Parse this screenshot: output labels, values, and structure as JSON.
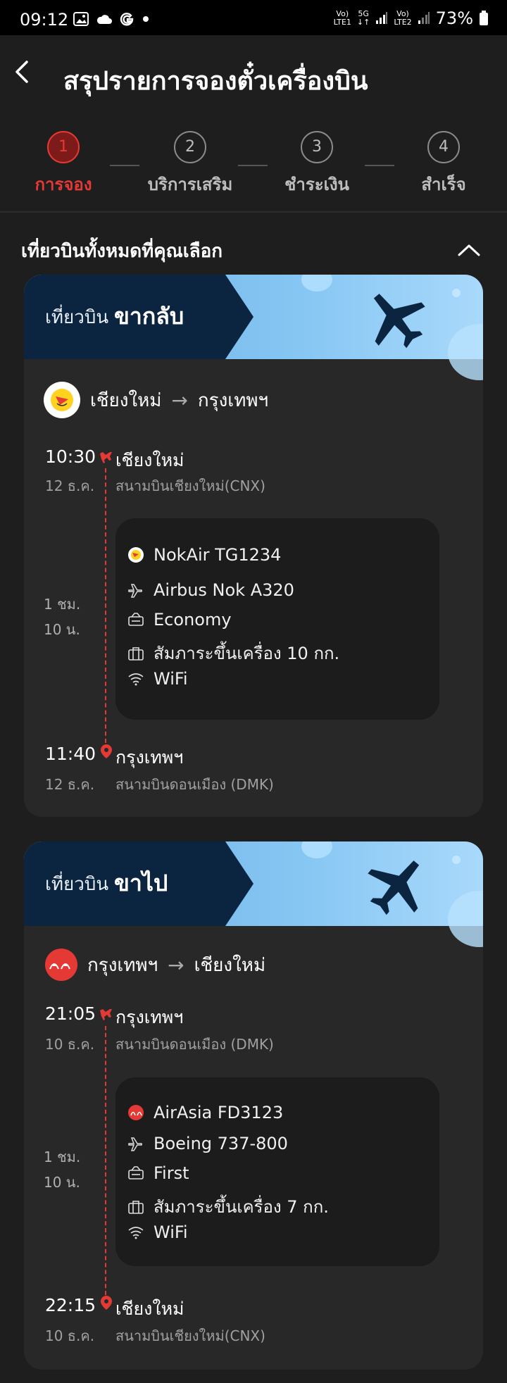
{
  "status_bar": {
    "time": "09:12",
    "signal1": "Vo)\nLTE1",
    "signal_5g": "5G",
    "signal2": "Vo)\nLTE2",
    "battery": "73%"
  },
  "header": {
    "title": "สรุปรายการจองตั๋วเครื่องบิน"
  },
  "stepper": {
    "steps": [
      {
        "number": "1",
        "label": "การจอง",
        "active": true
      },
      {
        "number": "2",
        "label": "บริการเสริม",
        "active": false
      },
      {
        "number": "3",
        "label": "ชำระเงิน",
        "active": false
      },
      {
        "number": "4",
        "label": "สำเร็จ",
        "active": false
      }
    ]
  },
  "section": {
    "title": "เที่ยวบินทั้งหมดที่คุณเลือก"
  },
  "colors": {
    "accent": "#e53935",
    "banner_dark": "#0b2540",
    "banner_light": "#86c6f3"
  },
  "flights": [
    {
      "banner_label": "เที่ยวบิน",
      "direction": "ขากลับ",
      "from_city": "เชียงใหม่",
      "to_city": "กรุงเทพฯ",
      "airline_logo": "nok-logo-icon",
      "depart_time": "10:30",
      "depart_date": "12 ธ.ค.",
      "depart_city": "เชียงใหม่",
      "depart_airport": "สนามบินเชียงใหม่(CNX)",
      "duration_h": "1 ชม.",
      "duration_m": "10 น.",
      "flight": "NokAir TG1234",
      "aircraft": "Airbus Nok A320",
      "cabin": "Economy",
      "baggage": "สัมภาระขึ้นเครื่อง 10 กก.",
      "wifi": "WiFi",
      "arrive_time": "11:40",
      "arrive_date": "12 ธ.ค.",
      "arrive_city": "กรุงเทพฯ",
      "arrive_airport": "สนามบินดอนเมือง (DMK)"
    },
    {
      "banner_label": "เที่ยวบิน",
      "direction": "ขาไป",
      "from_city": "กรุงเทพฯ",
      "to_city": "เชียงใหม่",
      "airline_logo": "airasia-logo-icon",
      "depart_time": "21:05",
      "depart_date": "10 ธ.ค.",
      "depart_city": "กรุงเทพฯ",
      "depart_airport": "สนามบินดอนเมือง (DMK)",
      "duration_h": "1 ชม.",
      "duration_m": "10 น.",
      "flight": "AirAsia FD3123",
      "aircraft": "Boeing 737-800",
      "cabin": "First",
      "baggage": "สัมภาระขึ้นเครื่อง 7 กก.",
      "wifi": "WiFi",
      "arrive_time": "22:15",
      "arrive_date": "10 ธ.ค.",
      "arrive_city": "เชียงใหม่",
      "arrive_airport": "สนามบินเชียงใหม่(CNX)"
    }
  ]
}
